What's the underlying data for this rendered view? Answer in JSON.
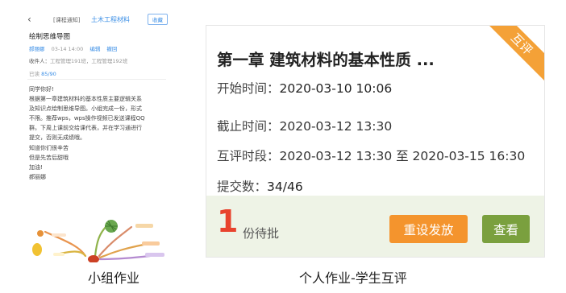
{
  "left_panel": {
    "back_icon": "back-arrow-icon",
    "course_tag": "[课程通知]",
    "course_name": "土木工程材料",
    "collect_label": "收藏",
    "title": "绘制思维导图",
    "author": "郝丽娜",
    "datetime": "03-14 14:00",
    "edit_label": "编辑",
    "withdraw_label": "撤回",
    "receivers_label": "收件人：",
    "receivers_value": "工程管理191班，工程管理192班",
    "read_label": "已读",
    "read_count": "85/90",
    "body_lines": [
      "同学你好!",
      "根据第一章建筑材料的基本性质主要逻辑关系",
      "及知识点绘制思维导图。小组完成一份，形式",
      "不限。推荐wps，wps操作视频已发送课程QQ",
      "群。下周上课前交给课代表，并在学习通进行",
      "提交，否则无成绩哦。",
      "知道你们很辛苦",
      "但是先苦后甜哦",
      "加油!",
      "郝丽娜"
    ]
  },
  "right_card": {
    "ribbon": "互评",
    "title": "第一章 建筑材料的基本性质 ...",
    "start_label": "开始时间：",
    "start_value": "2020-03-10 10:06",
    "end_label": "截止时间：",
    "end_value": "2020-03-12 13:30",
    "review_label": "互评时段：",
    "review_value": "2020-03-12 13:30 至 2020-03-15 16:30",
    "submit_label": "提交数：",
    "submit_value": "34/46",
    "pending_count": "1",
    "pending_label": "份待批",
    "reset_button": "重设发放",
    "view_button": "查看",
    "colors": {
      "ribbon": "#f4a137",
      "reset": "#f4942d",
      "view": "#7aa03e",
      "count": "#e8432e",
      "footer_bg": "#eef3e6"
    }
  },
  "captions": {
    "left": "小组作业",
    "right": "个人作业-学生互评"
  }
}
